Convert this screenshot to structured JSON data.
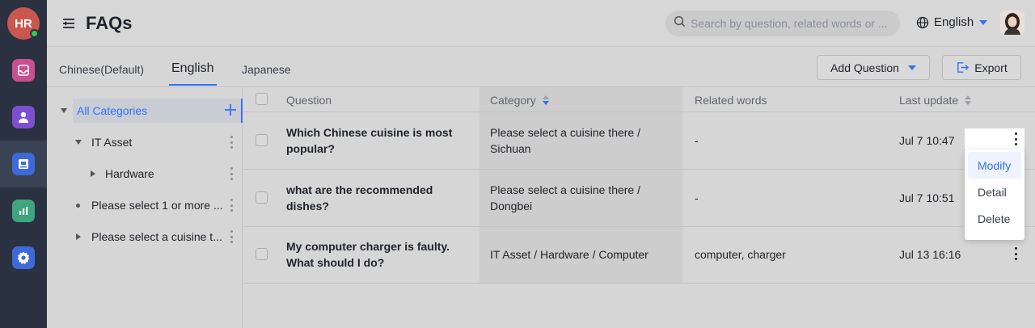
{
  "rail": {
    "avatar_initials": "HR",
    "items": [
      {
        "name": "inbox",
        "color": "#c94f8e"
      },
      {
        "name": "user",
        "color": "#7b4fd0"
      },
      {
        "name": "knowledge-base",
        "color": "#3e6ad9"
      },
      {
        "name": "analytics",
        "color": "#3ea57c"
      },
      {
        "name": "settings",
        "color": "#3e6ad9"
      }
    ]
  },
  "header": {
    "title": "FAQs",
    "search_placeholder": "Search by question, related words or ...",
    "language": "English"
  },
  "tabs": [
    {
      "label": "Chinese(Default)",
      "active": false
    },
    {
      "label": "English",
      "active": true
    },
    {
      "label": "Japanese",
      "active": false
    }
  ],
  "toolbar": {
    "add_question_label": "Add Question",
    "export_label": "Export"
  },
  "tree": [
    {
      "label": "All Categories",
      "level": 0,
      "expander": "down",
      "selected": true
    },
    {
      "label": "IT Asset",
      "level": 1,
      "expander": "down",
      "selected": false
    },
    {
      "label": "Hardware",
      "level": 2,
      "expander": "right",
      "selected": false
    },
    {
      "label": "Please select 1 or more ...",
      "level": 1,
      "expander": "bullet",
      "selected": false
    },
    {
      "label": "Please select a cuisine t...",
      "level": 1,
      "expander": "right",
      "selected": false
    }
  ],
  "table": {
    "columns": {
      "question": "Question",
      "category": "Category",
      "related": "Related words",
      "updated": "Last update"
    },
    "rows": [
      {
        "question": "Which Chinese cuisine is most popular?",
        "category": "Please select a cuisine there / Sichuan",
        "related": "-",
        "updated": "Jul 7 10:47"
      },
      {
        "question": "what are the recommended dishes?",
        "category": "Please select a cuisine there / Dongbei",
        "related": "-",
        "updated": "Jul 7 10:51"
      },
      {
        "question": "My computer charger is faulty. What should I do?",
        "category": "IT Asset / Hardware / Computer",
        "related": "computer, charger",
        "updated": "Jul 13 16:16"
      }
    ]
  },
  "context_menu": {
    "items": [
      {
        "label": "Modify",
        "active": true
      },
      {
        "label": "Detail",
        "active": false
      },
      {
        "label": "Delete",
        "active": false
      }
    ]
  },
  "colors": {
    "accent": "#3370ff",
    "rail_bg": "#2a3140",
    "avatar_bg": "#c9574f",
    "online": "#34c759"
  }
}
